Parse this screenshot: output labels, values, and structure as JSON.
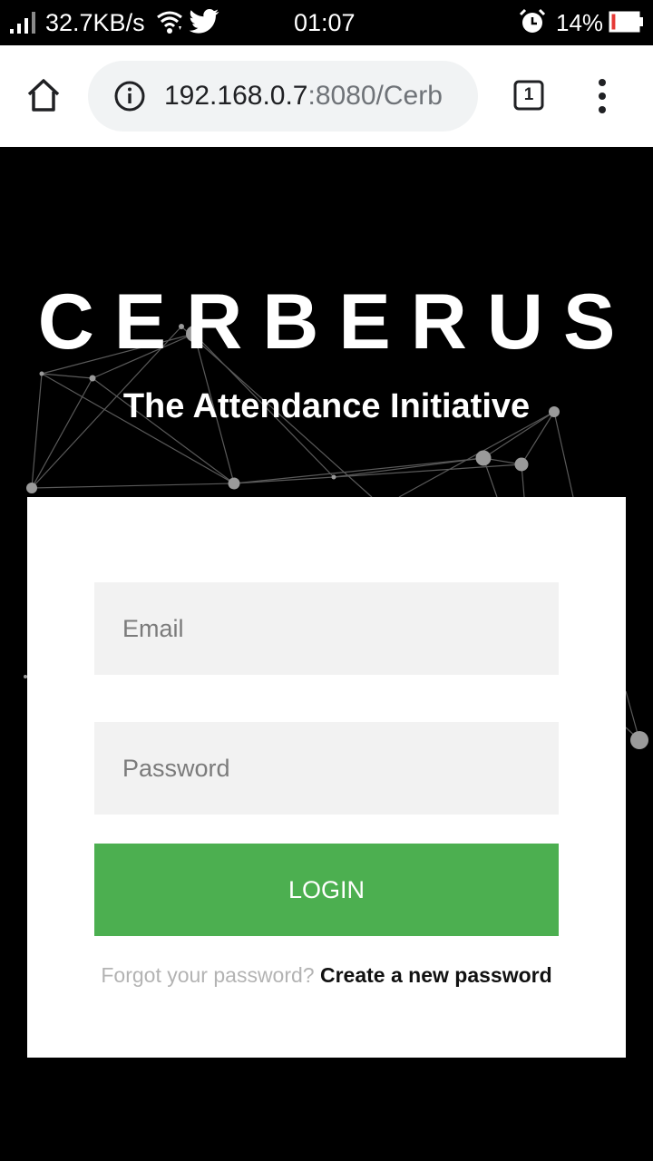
{
  "status_bar": {
    "net_speed": "32.7KB/s",
    "time": "01:07",
    "battery_percent": "14%",
    "battery_level": 0.14,
    "icons": [
      "signal-icon",
      "wifi-icon",
      "twitter-icon",
      "alarm-icon",
      "battery-icon"
    ]
  },
  "browser": {
    "url_host": "192.168.0.7",
    "url_rest": ":8080/Cerb",
    "tab_count": "1",
    "icons": [
      "home-icon",
      "info-icon",
      "tabs-icon",
      "menu-icon"
    ]
  },
  "hero": {
    "title": "CERBERUS",
    "subtitle": "The Attendance Initiative"
  },
  "login_form": {
    "email_placeholder": "Email",
    "password_placeholder": "Password",
    "login_label": "LOGIN",
    "forgot_text": "Forgot your password?",
    "create_link": "Create a new password"
  },
  "colors": {
    "accent": "#4caf50",
    "background": "#000000",
    "card": "#ffffff",
    "field": "#f2f2f2",
    "battery_low": "#e53935"
  }
}
